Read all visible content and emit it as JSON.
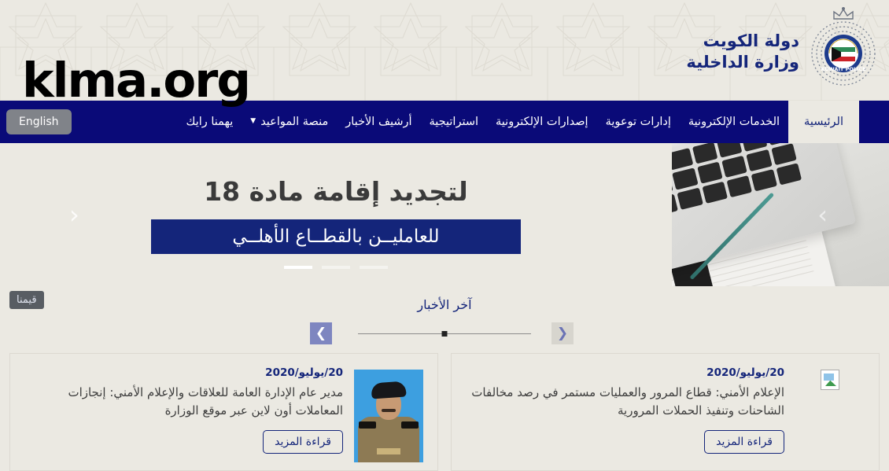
{
  "header": {
    "ministry_line1": "دولة الكويت",
    "ministry_line2": "وزارة الداخلية",
    "crest_label": "kuwait-police-crest",
    "watermark": "klma.org"
  },
  "nav": {
    "items": [
      {
        "label": "الرئيسية",
        "active": true,
        "dropdown": false
      },
      {
        "label": "الخدمات الإلكترونية",
        "active": false,
        "dropdown": false
      },
      {
        "label": "إدارات توعوية",
        "active": false,
        "dropdown": false
      },
      {
        "label": "إصدارات الإلكترونية",
        "active": false,
        "dropdown": false
      },
      {
        "label": "استراتيجية",
        "active": false,
        "dropdown": false
      },
      {
        "label": "أرشيف الأخبار",
        "active": false,
        "dropdown": false
      },
      {
        "label": "منصة المواعيد",
        "active": false,
        "dropdown": true
      },
      {
        "label": "يهمنا رايك",
        "active": false,
        "dropdown": false
      }
    ],
    "language_button": "English"
  },
  "hero": {
    "headline": "لتجديد إقامة مادة 18",
    "subheadline": "للعامليــن بالقطــاع الأهلــي",
    "prev_arrow": "‹",
    "next_arrow": "›",
    "slides_total": 3,
    "active_slide": 3,
    "photo_label": "laptop-notebook-photo"
  },
  "news": {
    "section_title": "آخر الأخبار",
    "prev_arrow": "❮",
    "next_arrow": "❯",
    "values_tab": "قيمنا",
    "read_more_label": "قراءة المزيد",
    "cards": [
      {
        "date": "20/يوليو/2020",
        "headline": "مدير عام الإدارة العامة للعلاقات والإعلام الأمني: إنجازات المعاملات أون لاين عبر موقع الوزارة",
        "thumb": "officer-portrait"
      },
      {
        "date": "20/يوليو/2020",
        "headline": "الإعلام الأمني: قطاع المرور والعمليات مستمر في رصد مخالفات الشاحنات وتنفيذ الحملات المرورية",
        "thumb": "broken-image"
      }
    ]
  },
  "colors": {
    "navy": "#0a0a78",
    "navy_text": "#14257a",
    "beige": "#ebe9e2",
    "gray_button": "#808389",
    "values_tab": "#585d63"
  }
}
